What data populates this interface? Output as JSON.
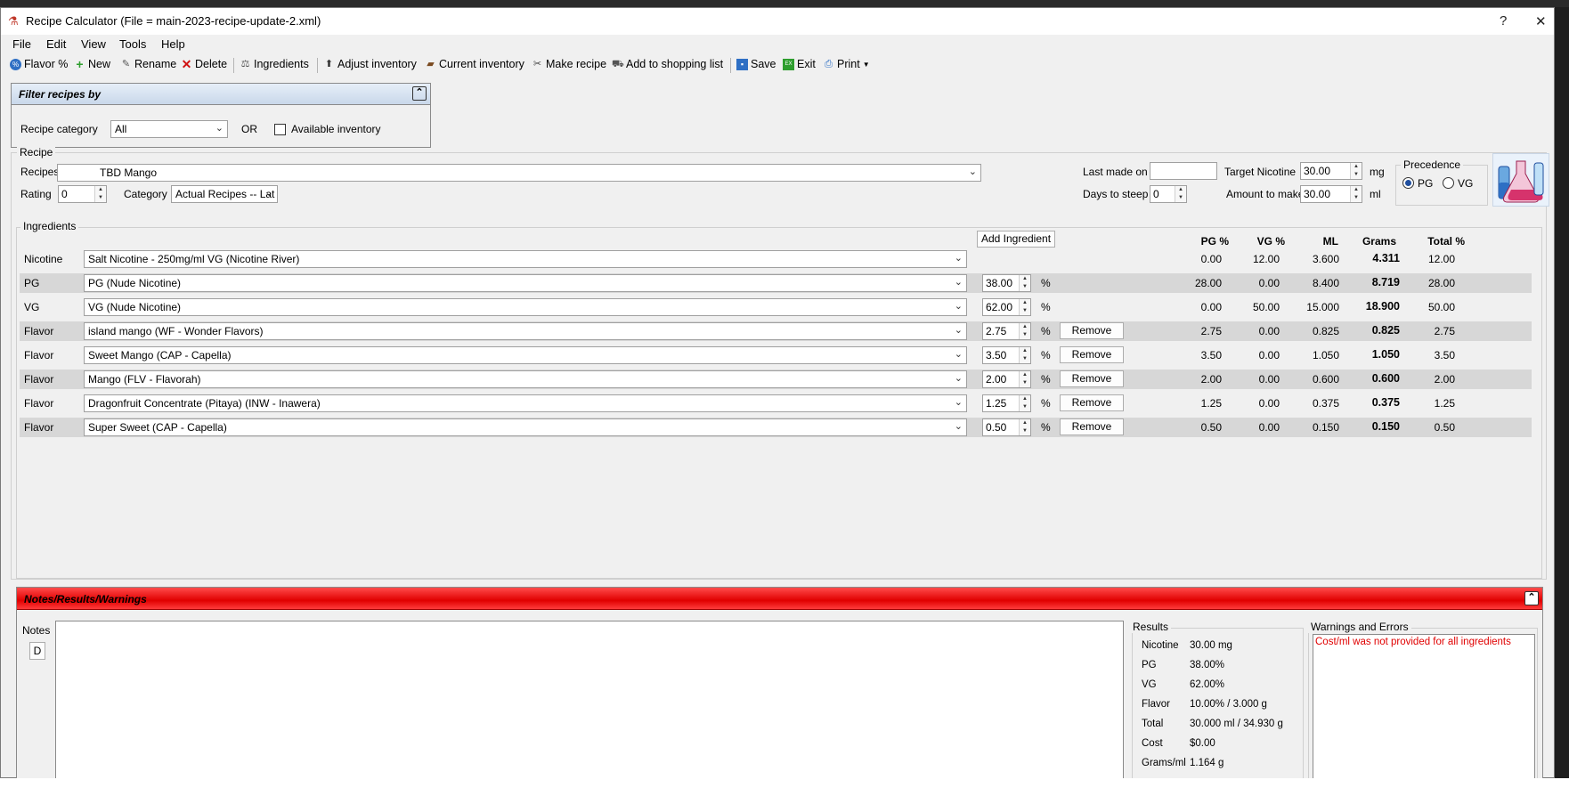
{
  "window": {
    "title": "Recipe Calculator (File = main-2023-recipe-update-2.xml)",
    "help_btn": "?",
    "close_btn": "✕"
  },
  "menu": [
    "File",
    "Edit",
    "View",
    "Tools",
    "Help"
  ],
  "toolbar": {
    "flavor_pct": "Flavor %",
    "new": "New",
    "rename": "Rename",
    "delete": "Delete",
    "ingredients": "Ingredients",
    "adjust_inventory": "Adjust inventory",
    "current_inventory": "Current inventory",
    "make_recipe": "Make recipe",
    "add_shopping": "Add to shopping list",
    "save": "Save",
    "exit": "Exit",
    "print": "Print"
  },
  "filter": {
    "title": "Filter recipes by",
    "category_label": "Recipe category",
    "category_value": "All",
    "or": "OR",
    "available_label": "Available inventory",
    "available_checked": false
  },
  "recipe": {
    "group_label": "Recipe",
    "recipes_label": "Recipes",
    "recipe_value": "TBD Mango",
    "rating_label": "Rating",
    "rating_value": "0",
    "category_label": "Category",
    "category_value": "Actual Recipes -- Lat",
    "last_made_label": "Last made on",
    "last_made_value": "",
    "days_steep_label": "Days to steep",
    "days_steep_value": "0",
    "target_nic_label": "Target Nicotine",
    "target_nic_value": "30.00",
    "target_nic_unit": "mg",
    "amount_label": "Amount to make",
    "amount_value": "30.00",
    "amount_unit": "ml",
    "precedence_label": "Precedence",
    "precedence_pg": "PG",
    "precedence_vg": "VG",
    "precedence_selected": "PG"
  },
  "ingredients": {
    "group_label": "Ingredients",
    "add_button": "Add Ingredient",
    "remove_label": "Remove",
    "pct_sign": "%",
    "headers": [
      "PG %",
      "VG %",
      "ML",
      "Grams",
      "Total %"
    ],
    "rows": [
      {
        "type": "Nicotine",
        "name": "Salt Nicotine - 250mg/ml VG (Nicotine River)",
        "pct": "",
        "pg": "0.00",
        "vg": "12.00",
        "ml": "3.600",
        "grams": "4.311",
        "total": "12.00"
      },
      {
        "type": "PG",
        "name": "PG (Nude Nicotine)",
        "pct": "38.00",
        "pg": "28.00",
        "vg": "0.00",
        "ml": "8.400",
        "grams": "8.719",
        "total": "28.00"
      },
      {
        "type": "VG",
        "name": "VG (Nude Nicotine)",
        "pct": "62.00",
        "pg": "0.00",
        "vg": "50.00",
        "ml": "15.000",
        "grams": "18.900",
        "total": "50.00"
      },
      {
        "type": "Flavor",
        "name": "island mango (WF - Wonder Flavors)",
        "pct": "2.75",
        "pg": "2.75",
        "vg": "0.00",
        "ml": "0.825",
        "grams": "0.825",
        "total": "2.75"
      },
      {
        "type": "Flavor",
        "name": "Sweet Mango (CAP - Capella)",
        "pct": "3.50",
        "pg": "3.50",
        "vg": "0.00",
        "ml": "1.050",
        "grams": "1.050",
        "total": "3.50"
      },
      {
        "type": "Flavor",
        "name": "Mango (FLV - Flavorah)",
        "pct": "2.00",
        "pg": "2.00",
        "vg": "0.00",
        "ml": "0.600",
        "grams": "0.600",
        "total": "2.00"
      },
      {
        "type": "Flavor",
        "name": "Dragonfruit Concentrate (Pitaya) (INW - Inawera)",
        "pct": "1.25",
        "pg": "1.25",
        "vg": "0.00",
        "ml": "0.375",
        "grams": "0.375",
        "total": "1.25"
      },
      {
        "type": "Flavor",
        "name": "Super Sweet (CAP - Capella)",
        "pct": "0.50",
        "pg": "0.50",
        "vg": "0.00",
        "ml": "0.150",
        "grams": "0.150",
        "total": "0.50"
      }
    ]
  },
  "notes": {
    "title": "Notes/Results/Warnings",
    "notes_label": "Notes",
    "d_button": "D",
    "results_label": "Results",
    "results": [
      {
        "label": "Nicotine",
        "value": "30.00 mg"
      },
      {
        "label": "PG",
        "value": "38.00%"
      },
      {
        "label": "VG",
        "value": "62.00%"
      },
      {
        "label": "Flavor",
        "value": "10.00% / 3.000 g"
      },
      {
        "label": "Total",
        "value": "30.000 ml / 34.930 g"
      },
      {
        "label": "Cost",
        "value": "$0.00"
      },
      {
        "label": "Grams/ml",
        "value": "1.164 g"
      }
    ],
    "warnings_label": "Warnings and Errors",
    "warning_text": "Cost/ml was not provided for all ingredients"
  },
  "colors": {
    "notes_header": "#e00000",
    "warning_text": "#e00000",
    "filter_header": "#c9d8ea"
  }
}
